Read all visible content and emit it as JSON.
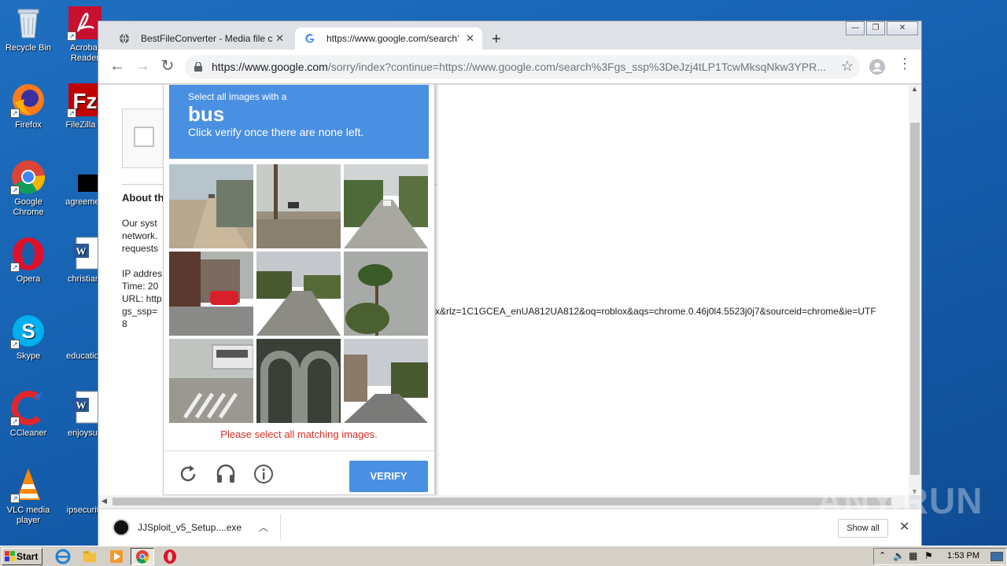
{
  "desktop": {
    "icons": [
      {
        "label": "Recycle Bin"
      },
      {
        "label": "Acrobat Reader"
      },
      {
        "label": "Firefox"
      },
      {
        "label": "FileZilla C"
      },
      {
        "label": "Google Chrome"
      },
      {
        "label": "agreemen"
      },
      {
        "label": "Opera"
      },
      {
        "label": "christianf"
      },
      {
        "label": "Skype"
      },
      {
        "label": "education"
      },
      {
        "label": "CCleaner"
      },
      {
        "label": "enjoysun"
      },
      {
        "label": "VLC media player"
      },
      {
        "label": "ipsecurity"
      }
    ]
  },
  "browser": {
    "tabs": [
      {
        "title": "BestFileConverter - Media file conver",
        "close": "✕"
      },
      {
        "title": "https://www.google.com/search?gs_",
        "close": "✕"
      }
    ],
    "new_tab": "+",
    "url_domain": "https://www.google.com",
    "url_rest": "/sorry/index?continue=https://www.google.com/search%3Fgs_ssp%3DeJzj4tLP1TcwMksqNkw3YPR..."
  },
  "page": {
    "about_heading": "About th",
    "body_lines": [
      "Our syst",
      "network.",
      "requests"
    ],
    "info_lines": [
      "IP addres",
      "Time: 20",
      "URL: http",
      "gs_ssp=",
      "8"
    ],
    "url_tail": "x&rlz=1C1GCEA_enUA812UA812&oq=roblox&aqs=chrome.0.46j0l4.5523j0j7&sourceid=chrome&ie=UTF"
  },
  "captcha": {
    "instruction_small": "Select all images with a",
    "target": "bus",
    "instruction_sub": "Click verify once there are none left.",
    "error": "Please select all matching images.",
    "verify": "VERIFY",
    "tiles": [
      {
        "scene": "highway-bridge"
      },
      {
        "scene": "utility-pole-street"
      },
      {
        "scene": "road-trees"
      },
      {
        "scene": "red-car-street"
      },
      {
        "scene": "suburban-road"
      },
      {
        "scene": "palm-tree"
      },
      {
        "scene": "bus-crosswalk"
      },
      {
        "scene": "building-arches"
      },
      {
        "scene": "street-buildings"
      }
    ]
  },
  "downloads": {
    "file": "JJSploit_v5_Setup....exe",
    "show_all": "Show all"
  },
  "taskbar": {
    "start": "Start",
    "clock": "1:53 PM"
  },
  "watermark": "ANY.RUN",
  "colors": {
    "captcha_blue": "#4a90e2",
    "error_red": "#d93025"
  }
}
